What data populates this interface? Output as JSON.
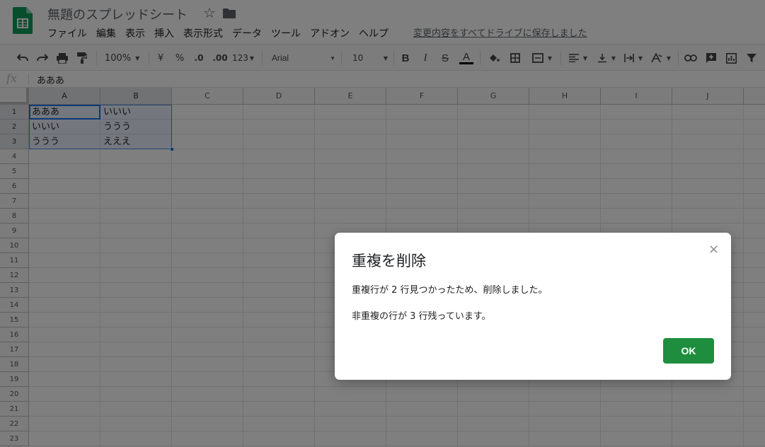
{
  "app": {
    "title": "無題のスプレッドシート",
    "star_glyph": "☆",
    "save_status": "変更内容をすべてドライブに保存しました"
  },
  "menu": [
    "ファイル",
    "編集",
    "表示",
    "挿入",
    "表示形式",
    "データ",
    "ツール",
    "アドオン",
    "ヘルプ"
  ],
  "toolbar": {
    "zoom": "100%",
    "currency": "¥",
    "percent": "%",
    "dec_decrease": ".0",
    "dec_increase": ".00",
    "format_more": "123",
    "font": "Arial",
    "font_size": "10",
    "bold": "B",
    "italic": "I",
    "strike": "S",
    "text_color": "A"
  },
  "formula_bar": {
    "fx": "fx",
    "value": "あああ"
  },
  "grid": {
    "columns": [
      "A",
      "B",
      "C",
      "D",
      "E",
      "F",
      "G",
      "H",
      "I",
      "J"
    ],
    "rows": [
      "1",
      "2",
      "3",
      "4",
      "5",
      "6",
      "7",
      "8",
      "9",
      "10",
      "11",
      "12",
      "13",
      "14",
      "15",
      "16",
      "17",
      "18",
      "19",
      "20",
      "21",
      "22",
      "23"
    ],
    "cells": [
      [
        "あああ",
        "いいい"
      ],
      [
        "いいい",
        "ううう"
      ],
      [
        "ううう",
        "えええ"
      ]
    ]
  },
  "dialog": {
    "title": "重複を削除",
    "close_glyph": "×",
    "message_1": "重複行が 2 行見つかったため、削除しました。",
    "message_2": "非重複の行が 3 行残っています。",
    "ok_label": "OK"
  },
  "colors": {
    "brand_green": "#0f9d58",
    "ok_button": "#1e8e3e",
    "selection_blue": "#1a73e8"
  }
}
